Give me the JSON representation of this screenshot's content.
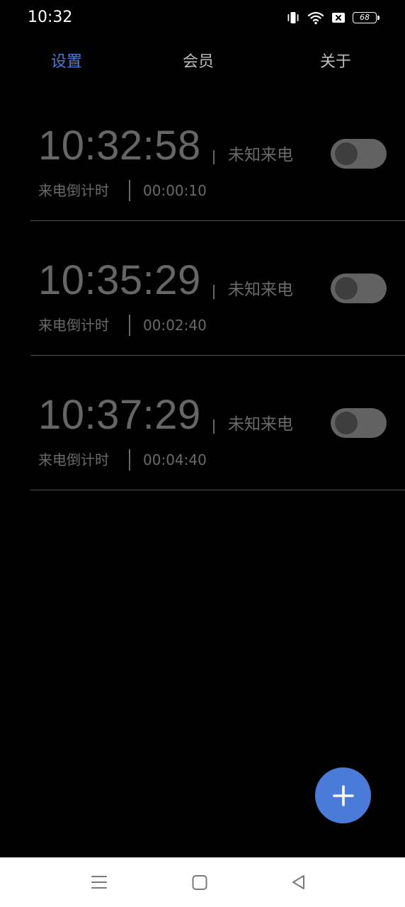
{
  "status_bar": {
    "time": "10:32",
    "battery_level": "68",
    "icons": [
      "vibrate-icon",
      "wifi-icon",
      "sim-blocked-icon",
      "battery-icon"
    ]
  },
  "tabs": [
    {
      "label": "设置",
      "active": true
    },
    {
      "label": "会员",
      "active": false
    },
    {
      "label": "关于",
      "active": false
    }
  ],
  "alarms": [
    {
      "time": "10:32:58",
      "caller": "未知来电",
      "label": "来电倒计时",
      "countdown": "00:00:10",
      "enabled": false
    },
    {
      "time": "10:35:29",
      "caller": "未知来电",
      "label": "来电倒计时",
      "countdown": "00:02:40",
      "enabled": false
    },
    {
      "time": "10:37:29",
      "caller": "未知来电",
      "label": "来电倒计时",
      "countdown": "00:04:40",
      "enabled": false
    }
  ],
  "fab": {
    "icon": "plus-icon"
  },
  "nav_bar": {
    "icons": [
      "menu-icon",
      "home-icon",
      "back-icon"
    ]
  },
  "colors": {
    "accent": "#4b7bd9",
    "background": "#000000",
    "muted_text": "#6a6a6a",
    "divider": "#505050",
    "toggle_off": "#626262"
  }
}
